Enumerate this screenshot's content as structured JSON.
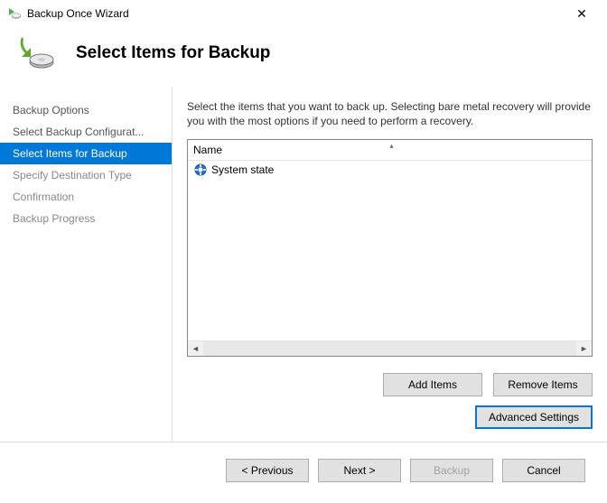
{
  "window": {
    "title": "Backup Once Wizard",
    "close_glyph": "✕"
  },
  "header": {
    "title": "Select Items for Backup"
  },
  "sidebar": {
    "items": [
      {
        "label": "Backup Options",
        "state": "normal"
      },
      {
        "label": "Select Backup Configurat...",
        "state": "normal"
      },
      {
        "label": "Select Items for Backup",
        "state": "active"
      },
      {
        "label": "Specify Destination Type",
        "state": "disabled"
      },
      {
        "label": "Confirmation",
        "state": "disabled"
      },
      {
        "label": "Backup Progress",
        "state": "disabled"
      }
    ]
  },
  "main": {
    "description": "Select the items that you want to back up. Selecting bare metal recovery will provide you with the most options if you need to perform a recovery.",
    "list": {
      "column_header": "Name",
      "items": [
        {
          "label": "System state",
          "icon": "system-state-icon"
        }
      ]
    },
    "buttons": {
      "add": "Add Items",
      "remove": "Remove Items",
      "advanced": "Advanced Settings"
    }
  },
  "footer": {
    "previous": "< Previous",
    "next": "Next >",
    "backup": "Backup",
    "cancel": "Cancel"
  }
}
